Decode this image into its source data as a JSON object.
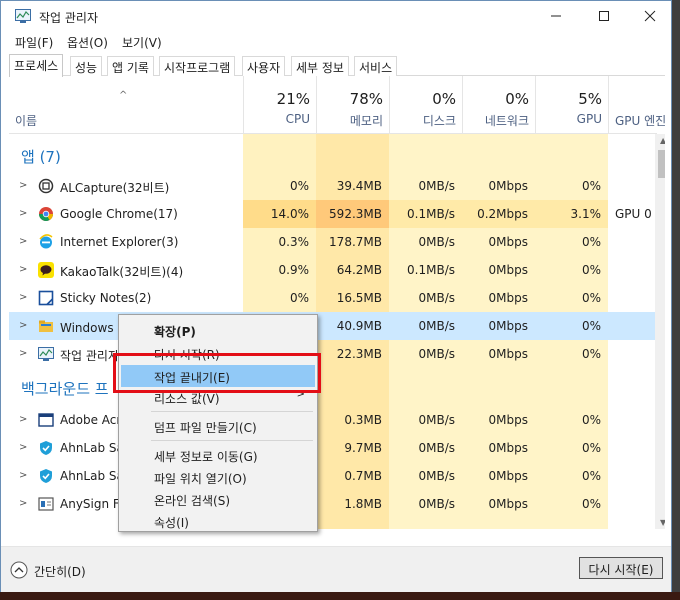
{
  "window": {
    "title": "작업 관리자"
  },
  "menubar": {
    "items": [
      "파일(F)",
      "옵션(O)",
      "보기(V)"
    ]
  },
  "tabs": [
    "프로세스",
    "성능",
    "앱 기록",
    "시작프로그램",
    "사용자",
    "세부 정보",
    "서비스"
  ],
  "columns": {
    "name_label": "이름",
    "cpu": {
      "pct": "21%",
      "label": "CPU"
    },
    "mem": {
      "pct": "78%",
      "label": "메모리"
    },
    "disk": {
      "pct": "0%",
      "label": "디스크"
    },
    "net": {
      "pct": "0%",
      "label": "네트워크"
    },
    "gpu": {
      "pct": "5%",
      "label": "GPU"
    },
    "gpu_engine": {
      "label": "GPU 엔진"
    }
  },
  "sections": {
    "apps": "앱 (7)",
    "background": "백그라운드 프"
  },
  "app_rows": [
    {
      "name": "ALCapture(32비트)",
      "cpu": "0%",
      "mem": "39.4MB",
      "disk": "0MB/s",
      "net": "0Mbps",
      "gpu": "0%",
      "engine": ""
    },
    {
      "name": "Google Chrome(17)",
      "cpu": "14.0%",
      "mem": "592.3MB",
      "disk": "0.1MB/s",
      "net": "0.2Mbps",
      "gpu": "3.1%",
      "engine": "GPU 0 -"
    },
    {
      "name": "Internet Explorer(3)",
      "cpu": "0.3%",
      "mem": "178.7MB",
      "disk": "0MB/s",
      "net": "0Mbps",
      "gpu": "0%",
      "engine": ""
    },
    {
      "name": "KakaoTalk(32비트)(4)",
      "cpu": "0.9%",
      "mem": "64.2MB",
      "disk": "0.1MB/s",
      "net": "0Mbps",
      "gpu": "0%",
      "engine": ""
    },
    {
      "name": "Sticky Notes(2)",
      "cpu": "0%",
      "mem": "16.5MB",
      "disk": "0MB/s",
      "net": "0Mbps",
      "gpu": "0%",
      "engine": ""
    },
    {
      "name": "Windows 탐",
      "cpu": "",
      "mem": "40.9MB",
      "disk": "0MB/s",
      "net": "0Mbps",
      "gpu": "0%",
      "engine": ""
    },
    {
      "name": "작업 관리자",
      "cpu": "",
      "mem": "22.3MB",
      "disk": "0MB/s",
      "net": "0Mbps",
      "gpu": "0%",
      "engine": ""
    }
  ],
  "bg_rows": [
    {
      "name": "Adobe Acro",
      "mem": "0.3MB",
      "disk": "0MB/s",
      "net": "0Mbps",
      "gpu": "0%"
    },
    {
      "name": "AhnLab Saf",
      "mem": "9.7MB",
      "disk": "0MB/s",
      "net": "0Mbps",
      "gpu": "0%"
    },
    {
      "name": "AhnLab Saf",
      "mem": "0.7MB",
      "disk": "0MB/s",
      "net": "0Mbps",
      "gpu": "0%"
    },
    {
      "name": "AnySign Fo",
      "mem": "1.8MB",
      "disk": "0MB/s",
      "net": "0Mbps",
      "gpu": "0%"
    }
  ],
  "context_menu": {
    "items": [
      "확장(P)",
      "다시 시작(R)",
      "작업 끝내기(E)",
      "리소스 값(V)",
      "덤프 파일 만들기(C)",
      "세부 정보로 이동(G)",
      "파일 위치 열기(O)",
      "온라인 검색(S)",
      "속성(I)"
    ]
  },
  "footer": {
    "collapse_label": "간단히(D)",
    "restart_label": "다시 시작(E)"
  },
  "colors": {
    "heat_light": "#fff4c4",
    "heat_mid": "#ffe59a",
    "heat_strong": "#ffd46e",
    "selection": "#cce8ff",
    "accent": "#1e73be",
    "highlight": "#e30e16"
  }
}
